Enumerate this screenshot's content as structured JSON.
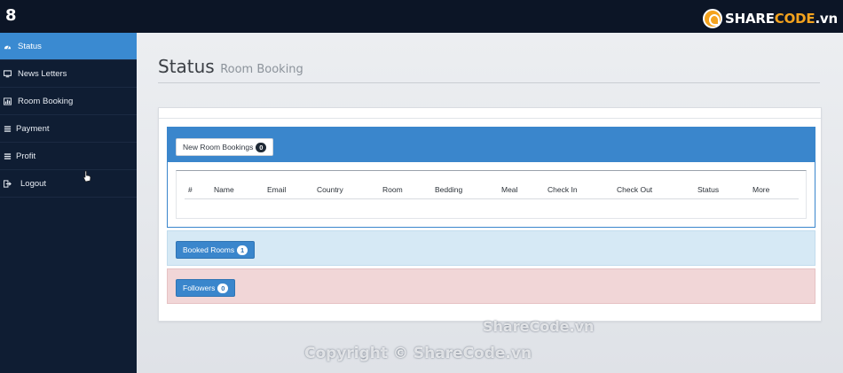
{
  "app": {
    "brand": "8"
  },
  "logo": {
    "part1": "SHARE",
    "part2": "CODE",
    "part3": ".vn"
  },
  "sidebar": {
    "items": [
      {
        "label": "Status",
        "icon": "dashboard-icon",
        "active": true
      },
      {
        "label": "News Letters",
        "icon": "desktop-icon",
        "active": false
      },
      {
        "label": "Room Booking",
        "icon": "chart-icon",
        "active": false
      },
      {
        "label": "Payment",
        "icon": "list-icon",
        "active": false
      },
      {
        "label": "Profit",
        "icon": "list-icon",
        "active": false
      },
      {
        "label": "Logout",
        "icon": "sign-out-icon",
        "active": false
      }
    ]
  },
  "page": {
    "title": "Status",
    "subtitle": "Room Booking"
  },
  "panels": {
    "new_bookings": {
      "label": "New Room Bookings",
      "count": "0"
    },
    "booked_rooms": {
      "label": "Booked Rooms",
      "count": "1"
    },
    "followers": {
      "label": "Followers",
      "count": "0"
    }
  },
  "table": {
    "headers": [
      "#",
      "Name",
      "Email",
      "Country",
      "Room",
      "Bedding",
      "Meal",
      "Check In",
      "Check Out",
      "Status",
      "More"
    ]
  },
  "watermark": {
    "line1": "ShareCode.vn",
    "line2": "Copyright © ShareCode.vn"
  },
  "colors": {
    "accent": "#3a86cc",
    "sidebar": "#0f1d33",
    "topbar": "#0c1526",
    "brand_orange": "#f4a31e"
  }
}
